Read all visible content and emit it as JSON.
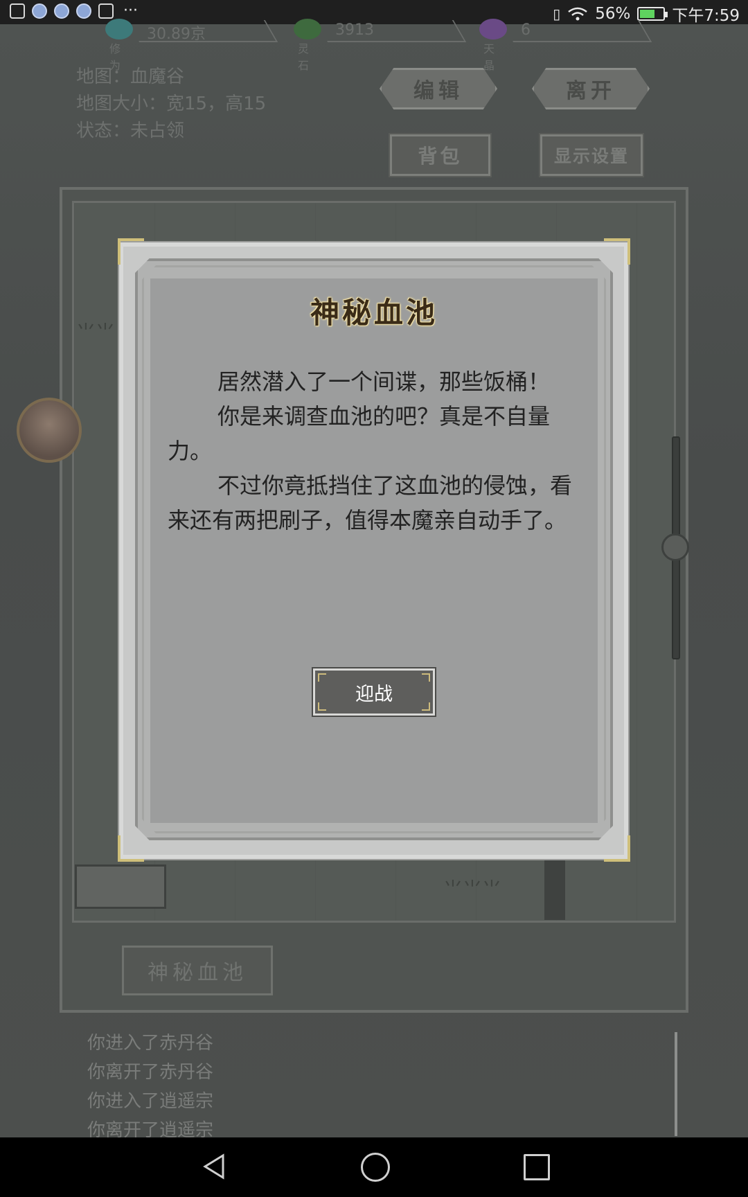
{
  "status_bar": {
    "more": "···",
    "battery": "56%",
    "time": "下午7:59"
  },
  "resources": [
    {
      "value": "30.89京",
      "label": "修为",
      "color": "#3d7a7a"
    },
    {
      "value": "3913",
      "label": "灵石",
      "color": "#3e6a3e"
    },
    {
      "value": "6",
      "label": "天晶",
      "color": "#6a4a86"
    }
  ],
  "map_info": {
    "name": "地图：血魔谷",
    "size": "地图大小：宽15，高15",
    "status": "状态：未占领"
  },
  "top_buttons": {
    "edit": "编辑",
    "leave": "离开",
    "bag": "背包",
    "display_settings": "显示设置"
  },
  "location_button": "神秘血池",
  "log": [
    "你进入了赤丹谷",
    "你离开了赤丹谷",
    "你进入了逍遥宗",
    "你离开了逍遥宗"
  ],
  "dialog": {
    "title": "神秘血池",
    "paragraphs": [
      "居然潜入了一个间谍，那些饭桶！",
      "你是来调查血池的吧？真是不自量力。",
      "不过你竟抵挡住了这血池的侵蚀，看来还有两把刷子，值得本魔亲自动手了。"
    ],
    "accept_button": "迎战"
  },
  "icons": {
    "nav": [
      "back-icon",
      "home-icon",
      "recent-apps-icon"
    ]
  }
}
